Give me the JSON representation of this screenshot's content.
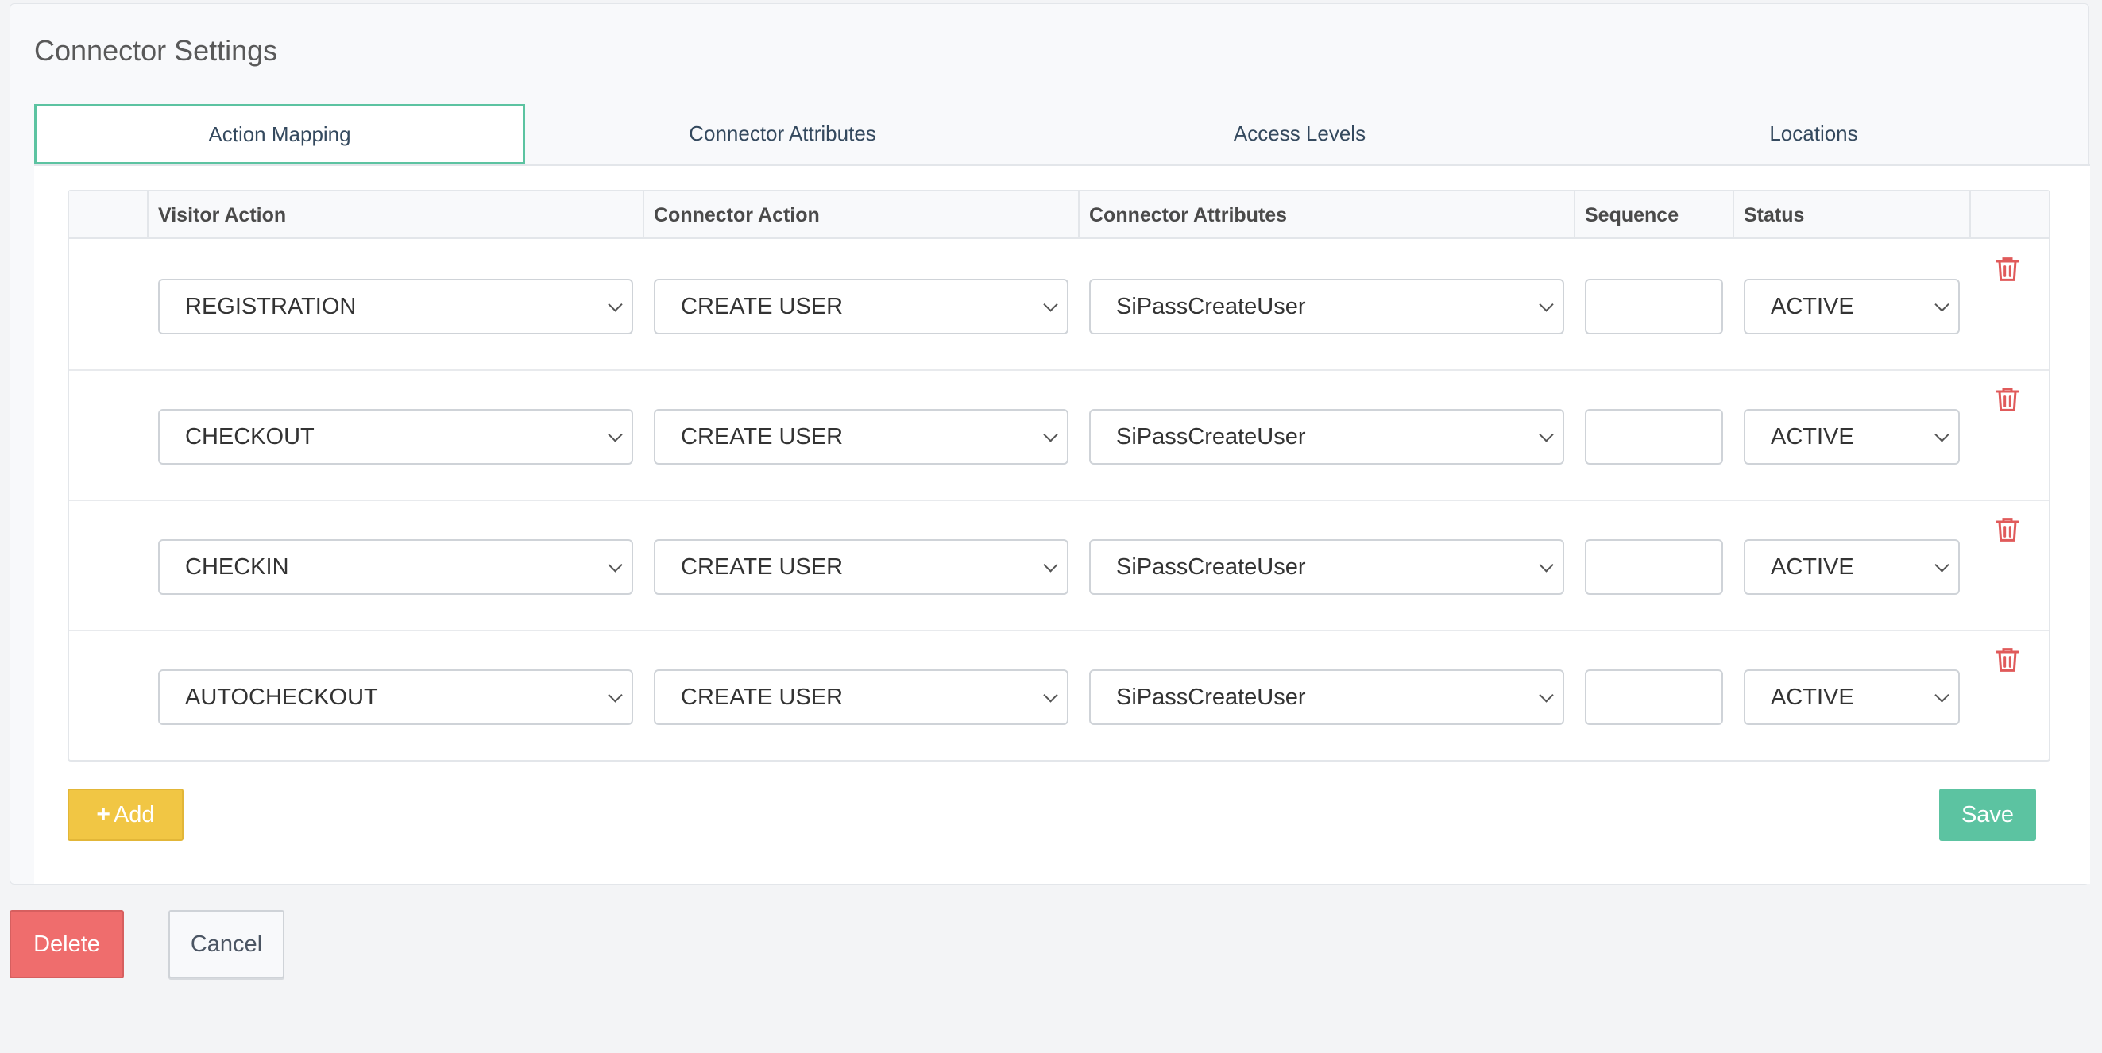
{
  "panel": {
    "title": "Connector Settings"
  },
  "tabs": [
    {
      "label": "Action Mapping",
      "active": true
    },
    {
      "label": "Connector Attributes",
      "active": false
    },
    {
      "label": "Access Levels",
      "active": false
    },
    {
      "label": "Locations",
      "active": false
    }
  ],
  "table": {
    "headers": {
      "visitor_action": "Visitor Action",
      "connector_action": "Connector Action",
      "connector_attributes": "Connector Attributes",
      "sequence": "Sequence",
      "status": "Status"
    },
    "rows": [
      {
        "visitor_action": "REGISTRATION",
        "connector_action": "CREATE USER",
        "connector_attributes": "SiPassCreateUser",
        "sequence": "",
        "status": "ACTIVE"
      },
      {
        "visitor_action": "CHECKOUT",
        "connector_action": "CREATE USER",
        "connector_attributes": "SiPassCreateUser",
        "sequence": "",
        "status": "ACTIVE"
      },
      {
        "visitor_action": "CHECKIN",
        "connector_action": "CREATE USER",
        "connector_attributes": "SiPassCreateUser",
        "sequence": "",
        "status": "ACTIVE"
      },
      {
        "visitor_action": "AUTOCHECKOUT",
        "connector_action": "CREATE USER",
        "connector_attributes": "SiPassCreateUser",
        "sequence": "",
        "status": "ACTIVE"
      }
    ]
  },
  "actions": {
    "add_label": "Add",
    "save_label": "Save",
    "delete_label": "Delete",
    "cancel_label": "Cancel"
  },
  "colors": {
    "accent_green": "#5cc3a1",
    "add_yellow": "#f1c644",
    "delete_red": "#ef6d6d",
    "trash_red": "#e05a5a"
  },
  "icons": {
    "row_delete": "trash-icon",
    "add": "plus-icon",
    "select": "chevron-down-icon"
  }
}
